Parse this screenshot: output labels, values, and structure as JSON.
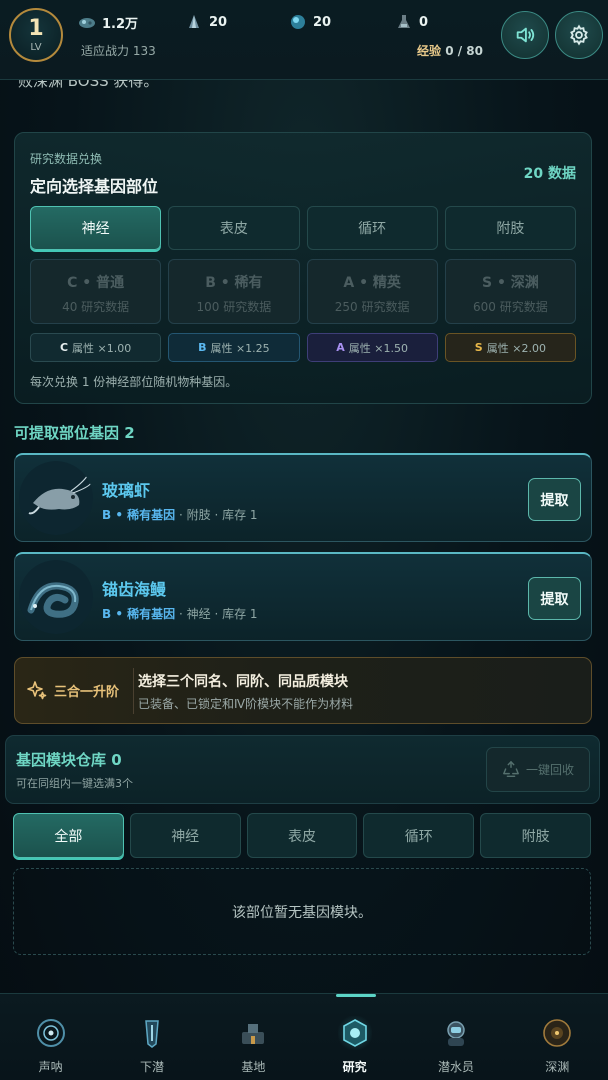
{
  "header": {
    "level": "1",
    "level_label": "LV",
    "resources": [
      {
        "icon": "shell-icon",
        "value": "1.2万"
      },
      {
        "icon": "crystal-icon",
        "value": "20"
      },
      {
        "icon": "orb-icon",
        "value": "20"
      },
      {
        "icon": "flask-icon",
        "value": "0"
      }
    ],
    "power_label": "适应战力 133",
    "exp_label": "经验",
    "exp_value": "0 / 80"
  },
  "cut_text": "败深渊 BOSS 获得。",
  "exchange": {
    "small_title": "研究数据兑换",
    "title": "定向选择基因部位",
    "count": "20 数据",
    "parts": [
      "神经",
      "表皮",
      "循环",
      "附肢"
    ],
    "active_part": "神经",
    "grades": [
      {
        "name": "C • 普通",
        "cost": "40 研究数据"
      },
      {
        "name": "B • 稀有",
        "cost": "100 研究数据"
      },
      {
        "name": "A • 精英",
        "cost": "250 研究数据"
      },
      {
        "name": "S • 深渊",
        "cost": "600 研究数据"
      }
    ],
    "multipliers": [
      {
        "grade": "C",
        "text": "属性 ×1.00"
      },
      {
        "grade": "B",
        "text": "属性 ×1.25"
      },
      {
        "grade": "A",
        "text": "属性 ×1.50"
      },
      {
        "grade": "S",
        "text": "属性 ×2.00"
      }
    ],
    "note": "每次兑换 1 份神经部位随机物种基因。"
  },
  "extractable": {
    "title": "可提取部位基因 2",
    "items": [
      {
        "name": "玻璃虾",
        "quality": "B • 稀有基因",
        "detail": "· 附肢 · 库存 1",
        "button": "提取"
      },
      {
        "name": "锚齿海鳗",
        "quality": "B • 稀有基因",
        "detail": "· 神经 · 库存 1",
        "button": "提取"
      }
    ]
  },
  "merge": {
    "label": "三合一升阶",
    "title": "选择三个同名、同阶、同品质模块",
    "subtitle": "已装备、已锁定和Ⅳ阶模块不能作为材料"
  },
  "warehouse": {
    "title": "基因模块仓库 0",
    "subtitle": "可在同组内一键选满3个",
    "recycle_label": "一键回收",
    "tabs": [
      "全部",
      "神经",
      "表皮",
      "循环",
      "附肢"
    ],
    "active_tab": "全部",
    "empty_text": "该部位暂无基因模块。"
  },
  "nav": {
    "items": [
      "声呐",
      "下潜",
      "基地",
      "研究",
      "潜水员",
      "深渊"
    ],
    "active": "研究"
  },
  "colors": {
    "accent": "#6fd6c4",
    "gold": "#e8c27a",
    "rare_blue": "#58b6ee"
  }
}
